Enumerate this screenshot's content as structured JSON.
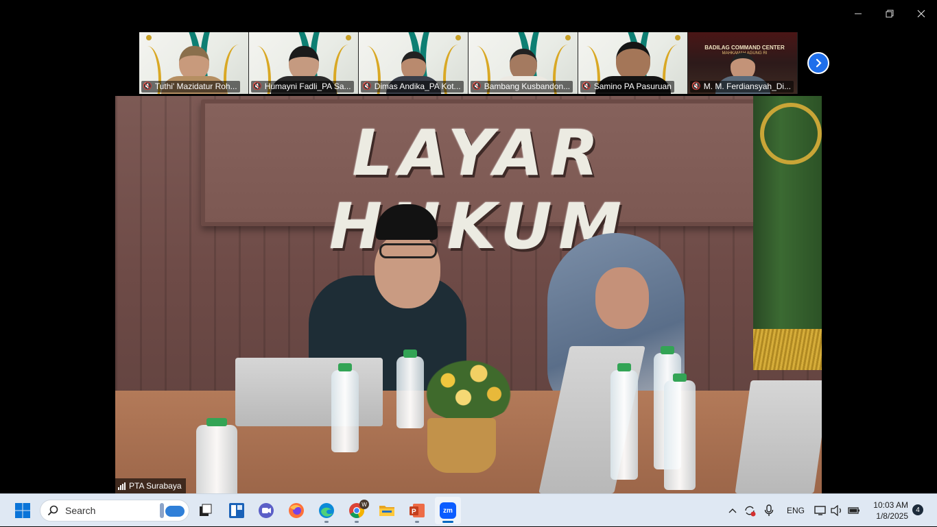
{
  "window": {
    "controls": {
      "minimize": "minimize-icon",
      "restore": "restore-icon",
      "close": "close-icon"
    }
  },
  "gallery": {
    "participants": [
      {
        "name": "Tuthi' Mazidatur Roh...",
        "muted": true
      },
      {
        "name": "Humayni Fadli_PA Sa...",
        "muted": true
      },
      {
        "name": "Dimas Andika_PA Kot...",
        "muted": true
      },
      {
        "name": "Bambang Kusbandon...",
        "muted": true
      },
      {
        "name": "Samino PA Pasuruan",
        "muted": true
      },
      {
        "name": "M. M. Ferdiansyah_Di...",
        "muted": true
      }
    ],
    "command_center_title": "BADILAG COMMAND CENTER",
    "command_center_sub": "MAHKAMAH AGUNG RI",
    "next_icon": "chevron-right-icon"
  },
  "main_video": {
    "sign_text": "LAYAR HUKUM",
    "speaker_name": "PTA Surabaya",
    "signal_icon": "signal-bars-icon"
  },
  "taskbar": {
    "search_placeholder": "Search",
    "apps": [
      {
        "name": "task-view",
        "icon": "task-view-icon"
      },
      {
        "name": "widgets",
        "icon": "widgets-icon"
      },
      {
        "name": "teams-chat",
        "icon": "teams-icon"
      },
      {
        "name": "firefox",
        "icon": "firefox-icon"
      },
      {
        "name": "edge",
        "icon": "edge-icon"
      },
      {
        "name": "chrome",
        "icon": "chrome-icon",
        "badge": "W"
      },
      {
        "name": "file-explorer",
        "icon": "folder-icon"
      },
      {
        "name": "powerpoint",
        "icon": "powerpoint-icon"
      },
      {
        "name": "zoom",
        "icon": "zoom-icon",
        "label": "zm",
        "active": true
      }
    ],
    "tray": {
      "language": "ENG"
    },
    "clock": {
      "time": "10:03 AM",
      "date": "1/8/2025"
    },
    "notification_count": "4"
  }
}
